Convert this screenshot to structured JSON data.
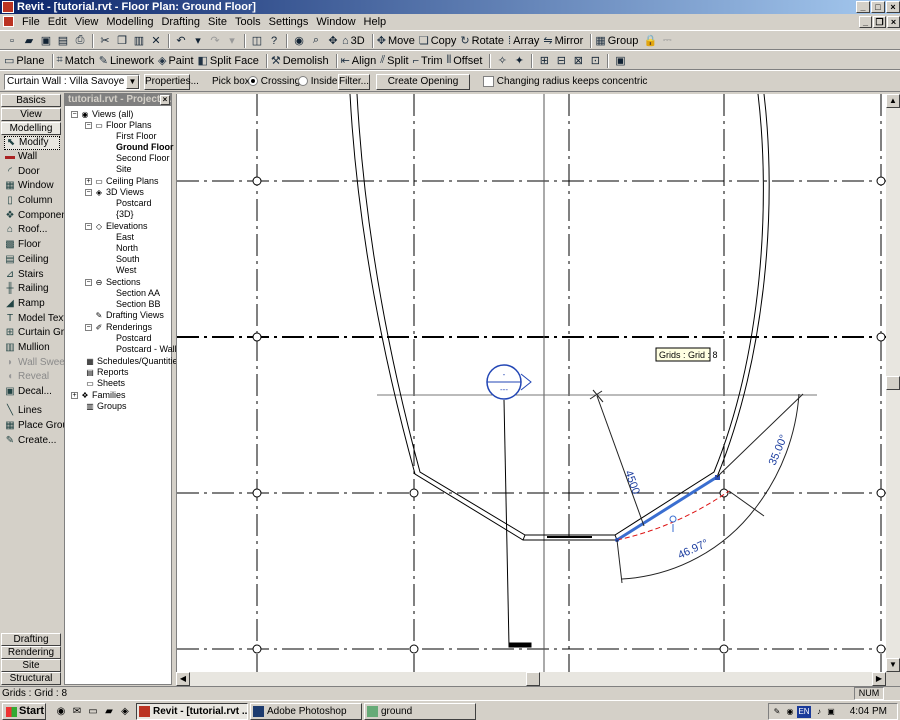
{
  "window": {
    "title": "Revit - [tutorial.rvt - Floor Plan: Ground Floor]"
  },
  "menu": [
    "File",
    "Edit",
    "View",
    "Modelling",
    "Drafting",
    "Site",
    "Tools",
    "Settings",
    "Window",
    "Help"
  ],
  "toolbar": {
    "view_3d": "3D",
    "move": "Move",
    "copy": "Copy",
    "rotate": "Rotate",
    "array": "Array",
    "mirror": "Mirror",
    "group": "Group",
    "plane": "Plane",
    "match": "Match",
    "linework": "Linework",
    "paint": "Paint",
    "split_face": "Split Face",
    "demolish": "Demolish",
    "align": "Align",
    "split": "Split",
    "trim": "Trim",
    "offset": "Offset"
  },
  "options_bar": {
    "type_selector": "Curtain Wall : Villa Savoye",
    "properties": "Properties...",
    "pick_box_label": "Pick box:",
    "crossing": "Crossing",
    "inside": "Inside",
    "filter": "Filter...",
    "create_opening": "Create Opening",
    "concentric_label": "Changing radius keeps concentric"
  },
  "design_bar": {
    "tabs_top": [
      "Basics",
      "View",
      "Modelling"
    ],
    "active_tab": "Modelling",
    "items": [
      {
        "label": "Modify",
        "icon": "cursor-icon"
      },
      {
        "label": "Wall",
        "icon": "wall-icon"
      },
      {
        "label": "Door",
        "icon": "door-icon"
      },
      {
        "label": "Window",
        "icon": "window-icon"
      },
      {
        "label": "Column",
        "icon": "column-icon"
      },
      {
        "label": "Component",
        "icon": "component-icon"
      },
      {
        "label": "Roof...",
        "icon": "roof-icon"
      },
      {
        "label": "Floor",
        "icon": "floor-icon"
      },
      {
        "label": "Ceiling",
        "icon": "ceiling-icon"
      },
      {
        "label": "Stairs",
        "icon": "stairs-icon"
      },
      {
        "label": "Railing",
        "icon": "railing-icon"
      },
      {
        "label": "Ramp",
        "icon": "ramp-icon"
      },
      {
        "label": "Model Text",
        "icon": "text-icon"
      },
      {
        "label": "Curtain Grid",
        "icon": "curtain-grid-icon"
      },
      {
        "label": "Mullion",
        "icon": "mullion-icon"
      },
      {
        "label": "Wall Sweep",
        "icon": "wall-sweep-icon"
      },
      {
        "label": "Reveal",
        "icon": "reveal-icon"
      },
      {
        "label": "Decal...",
        "icon": "decal-icon"
      },
      {
        "label": "Lines",
        "icon": "lines-icon"
      },
      {
        "label": "Place Group",
        "icon": "place-group-icon"
      },
      {
        "label": "Create...",
        "icon": "create-icon"
      }
    ],
    "tabs_bottom": [
      "Drafting",
      "Rendering",
      "Site",
      "Structural"
    ]
  },
  "browser": {
    "title": "tutorial.rvt - Project ...",
    "tree": [
      {
        "label": "Views (all)"
      },
      {
        "label": "Floor Plans"
      },
      {
        "label": "First Floor"
      },
      {
        "label": "Ground Floor"
      },
      {
        "label": "Second Floor"
      },
      {
        "label": "Site"
      },
      {
        "label": "Ceiling Plans"
      },
      {
        "label": "3D Views"
      },
      {
        "label": "Postcard"
      },
      {
        "label": "{3D}"
      },
      {
        "label": "Elevations"
      },
      {
        "label": "East"
      },
      {
        "label": "North"
      },
      {
        "label": "South"
      },
      {
        "label": "West"
      },
      {
        "label": "Sections"
      },
      {
        "label": "Section AA"
      },
      {
        "label": "Section BB"
      },
      {
        "label": "Drafting Views"
      },
      {
        "label": "Renderings"
      },
      {
        "label": "Postcard"
      },
      {
        "label": "Postcard - Wall-"
      },
      {
        "label": "Schedules/Quantities"
      },
      {
        "label": "Reports"
      },
      {
        "label": "Sheets"
      },
      {
        "label": "Families"
      },
      {
        "label": "Groups"
      }
    ]
  },
  "canvas": {
    "tooltip": "Grids : Grid : 8",
    "dim_length": "4500",
    "dim_angle_a": "35.00°",
    "dim_angle_b": "46.97°",
    "tag_top": "-",
    "tag_bottom": "---"
  },
  "status": {
    "text": "Grids : Grid : 8",
    "num": "NUM"
  },
  "taskbar": {
    "start": "Start",
    "tasks": [
      "Revit - [tutorial.rvt ...",
      "Adobe Photoshop",
      "ground"
    ],
    "lang": "EN",
    "clock": "4:04 PM"
  }
}
